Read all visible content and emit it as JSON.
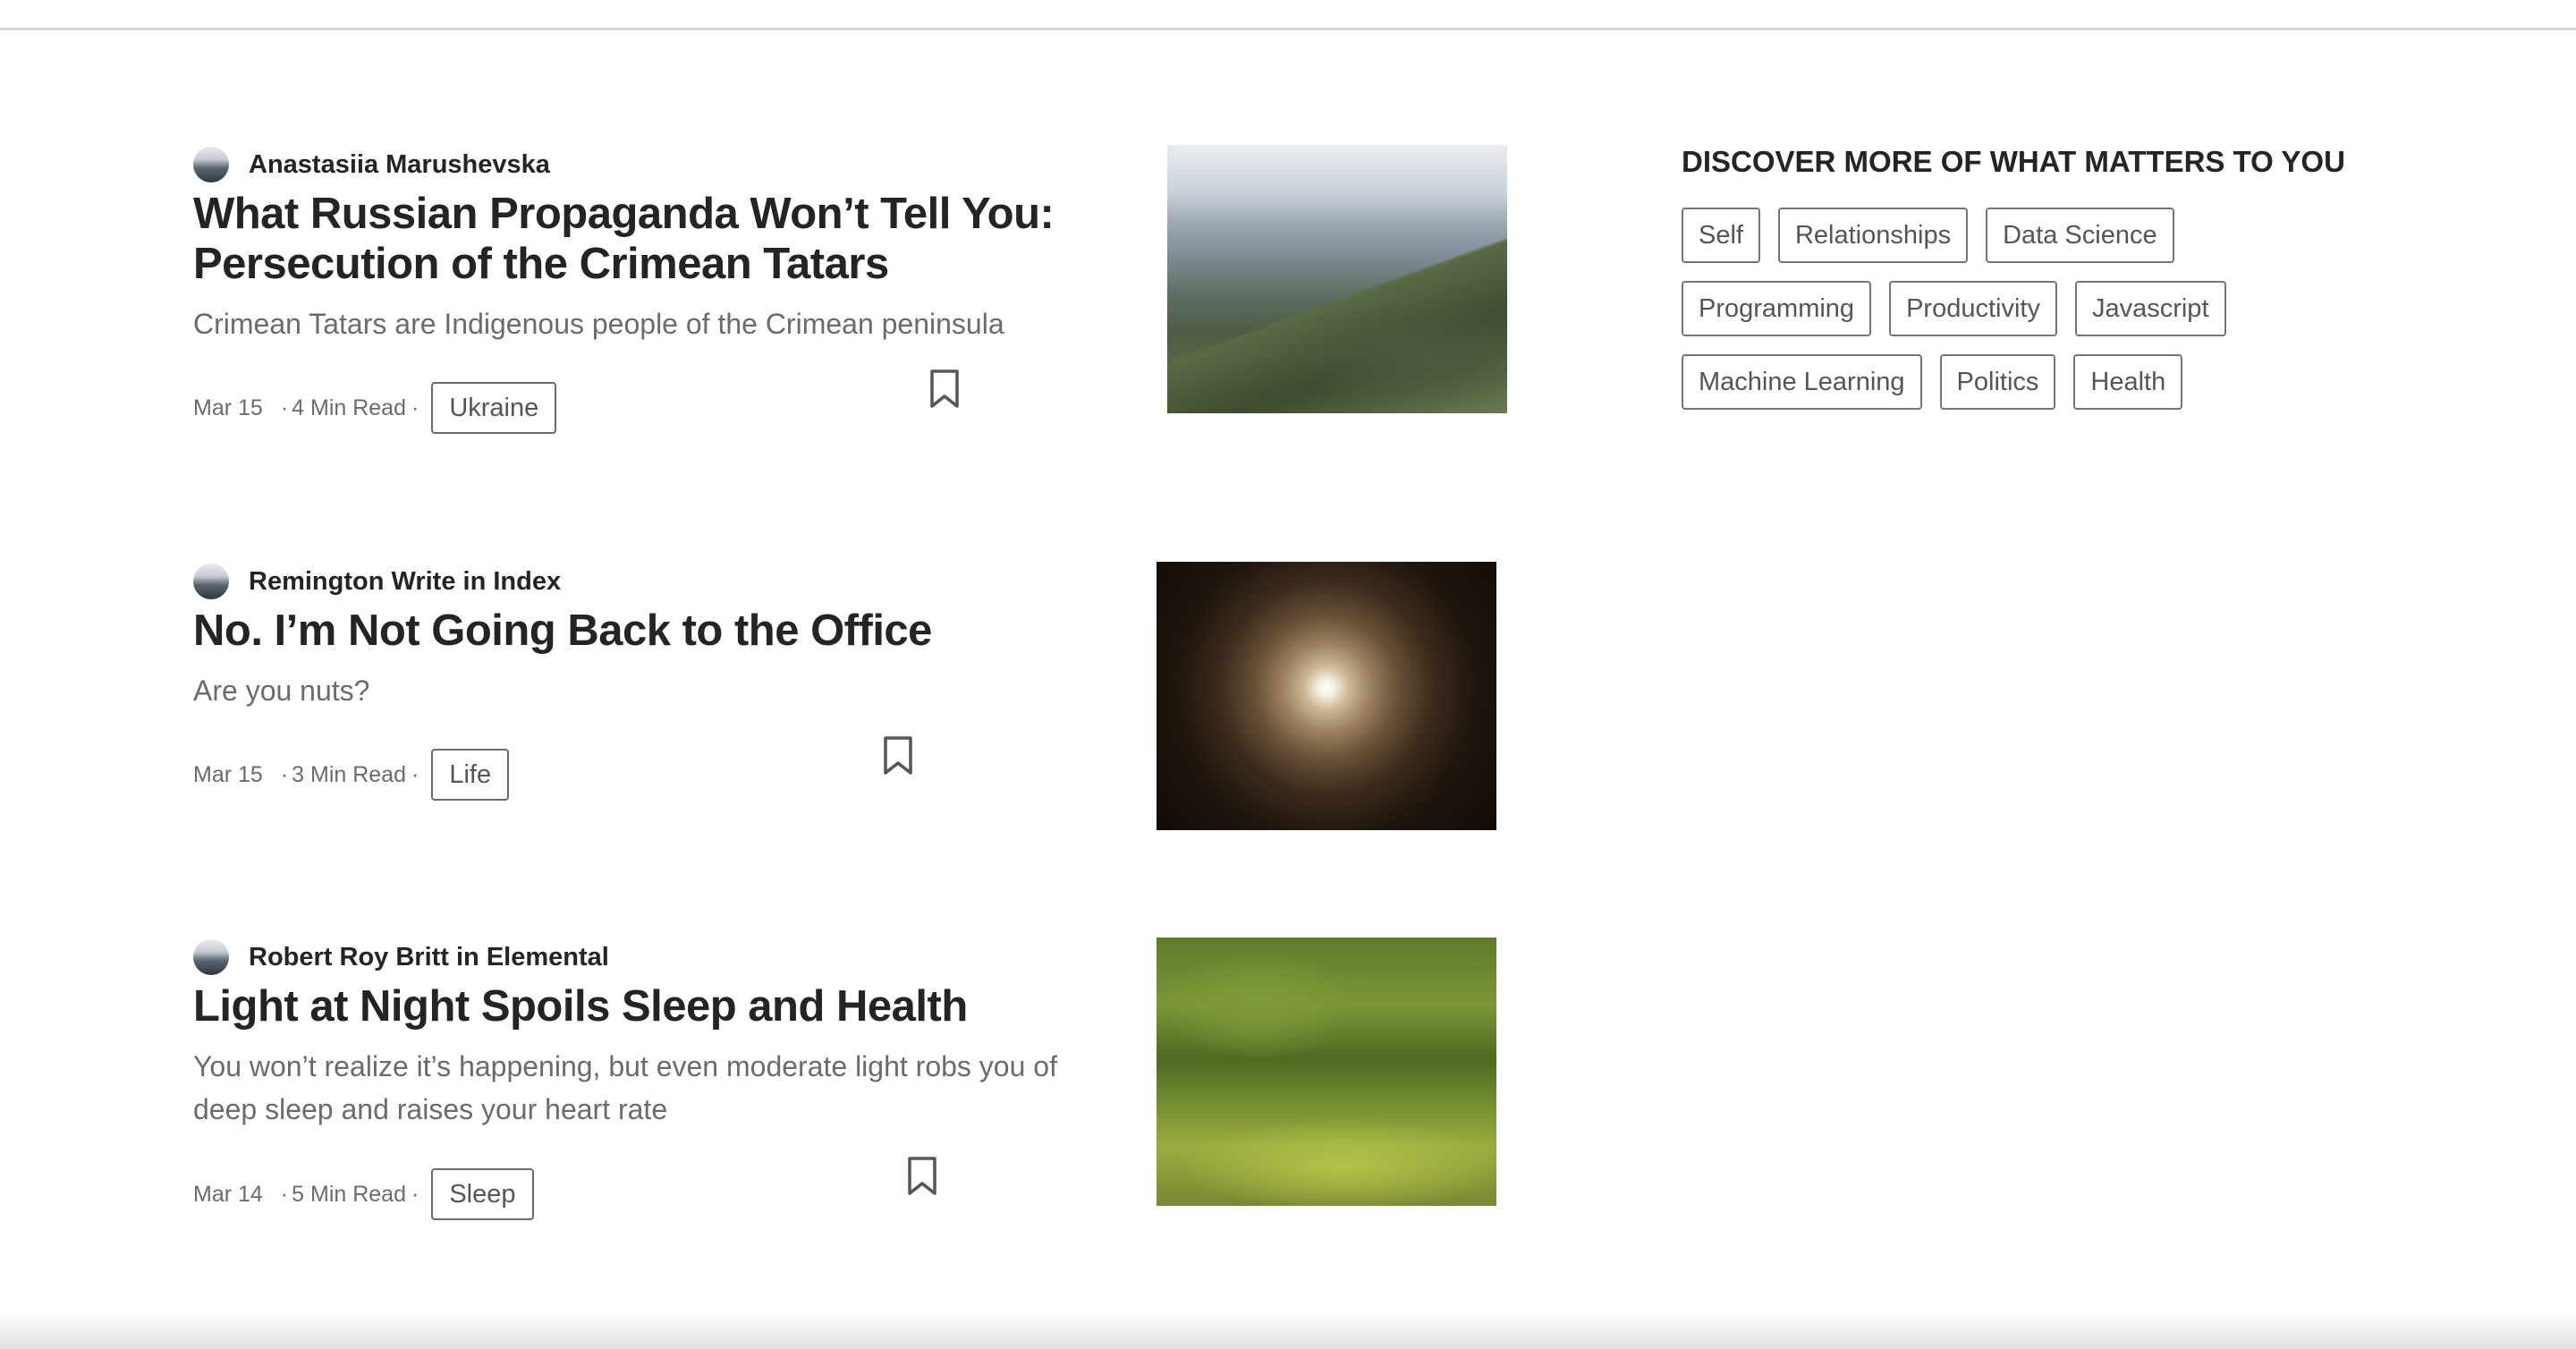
{
  "articles": [
    {
      "author": "Anastasiia Marushevska",
      "title_lines": [
        "What Russian Propaganda Won’t Tell You:",
        "Persecution of the Crimean Tatars"
      ],
      "subtitle_lines": [
        "Crimean Tatars are Indigenous people of the Crimean peninsula"
      ],
      "date": "Mar 15",
      "read_time": "4 Min Read",
      "tag": "Ukraine"
    },
    {
      "author": "Remington Write in Index",
      "title_lines": [
        "No. I’m Not Going Back to the Office"
      ],
      "subtitle_lines": [
        "Are you nuts?"
      ],
      "date": "Mar 15",
      "read_time": "3 Min Read",
      "tag": "Life"
    },
    {
      "author": "Robert Roy Britt in Elemental",
      "title_lines": [
        "Light at Night Spoils Sleep and Health"
      ],
      "subtitle_lines": [
        "You won’t realize it’s happening, but even moderate light robs you of",
        "deep sleep and raises your heart rate"
      ],
      "date": "Mar 14",
      "read_time": "5 Min Read",
      "tag": "Sleep"
    }
  ],
  "sidebar": {
    "title": "DISCOVER MORE OF WHAT MATTERS TO YOU",
    "topics": [
      "Self",
      "Relationships",
      "Data Science",
      "Programming",
      "Productivity",
      "Javascript",
      "Machine Learning",
      "Politics",
      "Health"
    ]
  },
  "icons": {
    "bookmark": "bookmark-icon"
  },
  "colors": {
    "text_primary": "#242424",
    "text_secondary": "#6b6b6b",
    "chip_border": "#757575"
  }
}
